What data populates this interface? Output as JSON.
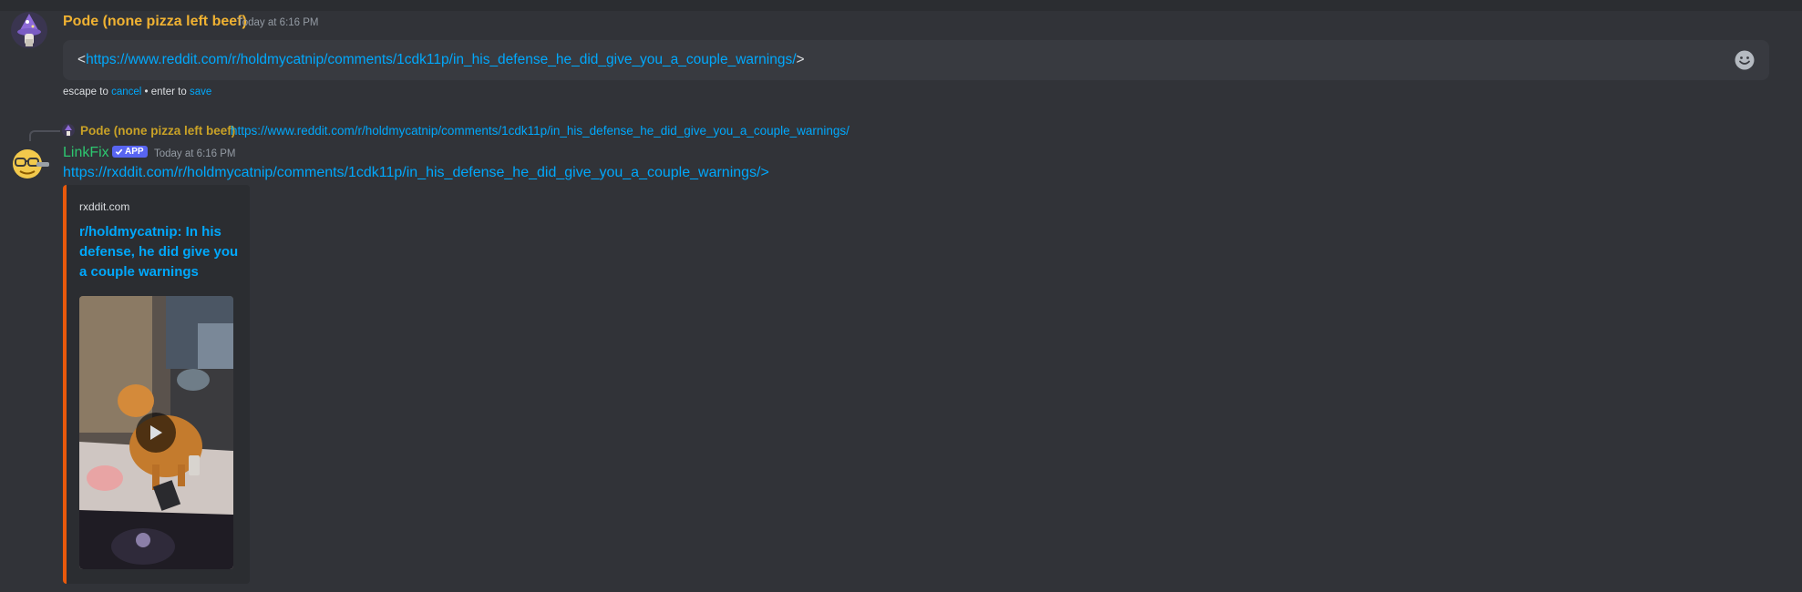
{
  "edit_message": {
    "author": "Pode (none pizza left beef)",
    "timestamp": "Today at 6:16 PM",
    "author_color": "#f0b232",
    "input_prefix": "<",
    "input_url": "https://www.reddit.com/r/holdmycatnip/comments/1cdk11p/in_his_defense_he_did_give_you_a_couple_warnings/",
    "input_suffix": ">",
    "emoji_button_icon": "emoji-smile-icon",
    "hint": {
      "escape_to": "escape to ",
      "cancel": "cancel",
      "enter_to": " • enter to ",
      "save": "save"
    }
  },
  "bot_message": {
    "reply": {
      "author": "Pode (none pizza left beef)",
      "text": "https://www.reddit.com/r/holdmycatnip/comments/1cdk11p/in_his_defense_he_did_give_you_a_couple_warnings/"
    },
    "author": "LinkFix",
    "author_color": "#2dc770",
    "badge": "APP",
    "timestamp": "Today at 6:16 PM",
    "link": "https://rxddit.com/r/holdmycatnip/comments/1cdk11p/in_his_defense_he_did_give_you_a_couple_warnings/>",
    "embed": {
      "provider": "rxddit.com",
      "title": "r/holdmycatnip: In his defense, he did give you a couple warnings",
      "accent_color": "#e8590c",
      "media_icon": "play-icon"
    }
  }
}
